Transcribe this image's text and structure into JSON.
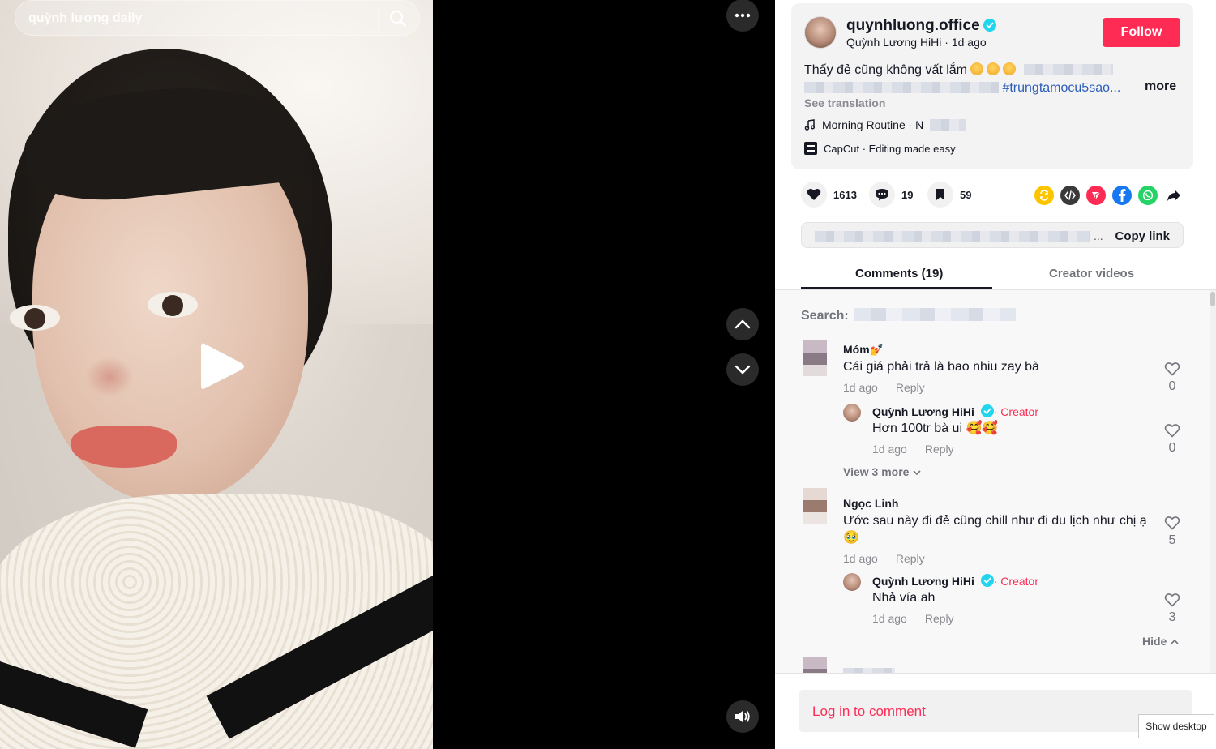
{
  "video": {
    "search_text": "quỳnh lương daily"
  },
  "post": {
    "username": "quynhluong.office",
    "display_name": "Quỳnh Lương HiHi",
    "separator": " · ",
    "posted": "1d ago",
    "follow_label": "Follow",
    "description_text": "Thấy đẻ cũng không vất lắm",
    "hashtag": "#trungtamocu5sao...",
    "more_label": "more",
    "see_translation": "See translation",
    "music": "Morning Routine - N",
    "capcut": "CapCut · Editing made easy"
  },
  "actions": {
    "likes": "1613",
    "comments": "19",
    "saves": "59"
  },
  "share_icons": [
    "repost-icon",
    "embed-icon",
    "send-icon",
    "facebook-icon",
    "whatsapp-icon",
    "share-arrow-icon"
  ],
  "link": {
    "text": "...",
    "copy_label": "Copy link"
  },
  "tabs": {
    "comments": "Comments (19)",
    "creator_videos": "Creator videos"
  },
  "comments_search_label": "Search:",
  "comments": [
    {
      "name": "Móm💅",
      "text": "Cái giá phải trả là bao nhiu zay bà",
      "time": "1d ago",
      "reply": "Reply",
      "likes": "0",
      "reply_item": {
        "name": "Quỳnh Lương HiHi",
        "tag": "· Creator",
        "text": "Hơn 100tr bà ui 🥰🥰",
        "time": "1d ago",
        "reply": "Reply",
        "likes": "0"
      },
      "view_more": "View 3 more"
    },
    {
      "name": "Ngọc Linh",
      "text": "Ước sau này đi đẻ cũng chill như đi du lịch như chị ạ 🥹",
      "time": "1d ago",
      "reply": "Reply",
      "likes": "5",
      "reply_item": {
        "name": "Quỳnh Lương HiHi",
        "tag": "· Creator",
        "text": "Nhả vía ah",
        "time": "1d ago",
        "reply": "Reply",
        "likes": "3"
      },
      "hide": "Hide"
    }
  ],
  "login_prompt": "Log in to comment",
  "tooltip": "Show desktop",
  "colors": {
    "accent": "#fe2c55",
    "hashtag": "#2b5db9",
    "verified": "#20d5ec"
  }
}
